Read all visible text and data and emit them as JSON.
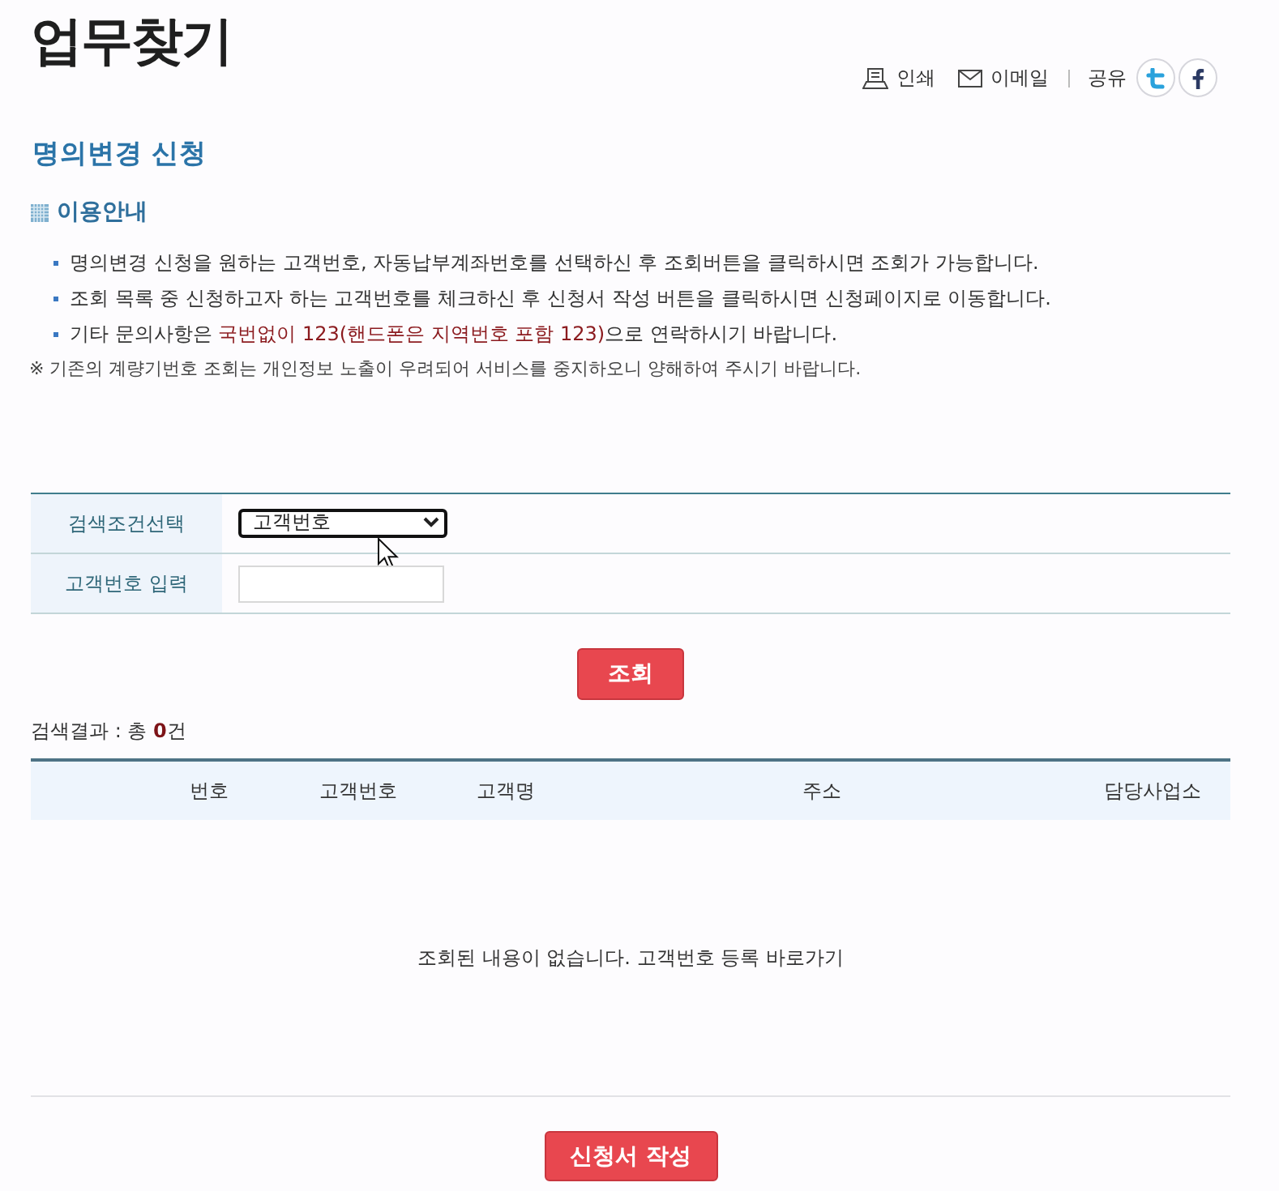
{
  "page": {
    "title": "업무찾기"
  },
  "utility_links": [
    {
      "kind": "print",
      "label": "인쇄"
    },
    {
      "kind": "email",
      "label": "이메일"
    }
  ],
  "share": {
    "label": "공유"
  },
  "section_title": "명의변경 신청",
  "guide": {
    "heading": "이용안내",
    "items": [
      {
        "segments": [
          {
            "text": "명의변경 신청을 원하는 고객번호, 자동납부계좌번호를 선택하신 후 조회버튼을 클릭하시면 조회가 가능합니다.",
            "highlight": false
          }
        ]
      },
      {
        "segments": [
          {
            "text": "조회 목록 중 신청하고자 하는 고객번호를 체크하신 후 신청서 작성 버튼을 클릭하시면 신청페이지로 이동합니다.",
            "highlight": false
          }
        ]
      },
      {
        "segments": [
          {
            "text": "기타 문의사항은 ",
            "highlight": false
          },
          {
            "text": "국번없이 123(핸드폰은 지역번호 포함 123)",
            "highlight": true
          },
          {
            "text": "으로 연락하시기 바랍니다.",
            "highlight": false
          }
        ]
      }
    ],
    "note": "※ 기존의 계량기번호 조회는 개인정보 노출이 우려되어 서비스를 중지하오니 양해하여 주시기 바랍니다."
  },
  "search_form": {
    "rows": [
      {
        "kind": "select",
        "label": "검색조건선택",
        "value": "고객번호",
        "focused": true
      },
      {
        "kind": "input",
        "label": "고객번호 입력",
        "focused": false
      }
    ],
    "button": "조회"
  },
  "result_count": "검색결과 : 총 **0**건",
  "results_table": {
    "columns": [
      "번호",
      "고객번호",
      "고객명",
      "주소",
      "담당사업소"
    ],
    "empty_message": {
      "text": "조회된 내용이 없습니다.",
      "link": "고객번호 등록 바로가기"
    }
  },
  "submit_button": "신청서 작성"
}
